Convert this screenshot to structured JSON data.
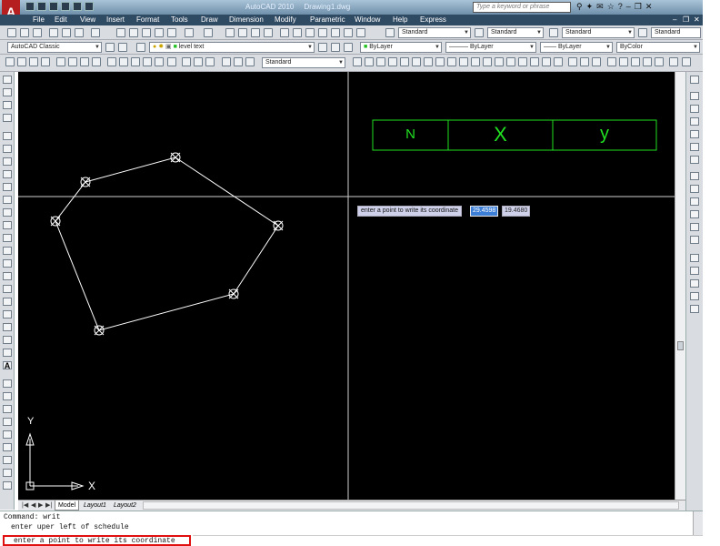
{
  "window": {
    "app_title": "AutoCAD 2010",
    "document_title": "Drawing1.dwg",
    "search_placeholder": "Type a keyword or phrase"
  },
  "menu": [
    "File",
    "Edit",
    "View",
    "Insert",
    "Format",
    "Tools",
    "Draw",
    "Dimension",
    "Modify",
    "Parametric",
    "Window",
    "Help",
    "Express"
  ],
  "toolbar1": {
    "text_style": "Standard",
    "dim_style": "Standard",
    "table_style": "Standard",
    "multileader_style": "Standard"
  },
  "toolbar2": {
    "workspace": "AutoCAD Classic",
    "layer": "level text",
    "color": "ByLayer",
    "linetype": "ByLayer",
    "lineweight": "ByLayer",
    "plot_style": "ByColor"
  },
  "toolbar3": {
    "dim_style": "Standard"
  },
  "schedule": {
    "headers": [
      "N",
      "X",
      "y"
    ]
  },
  "dynamic_input": {
    "prompt": "enter a point to write its coordinate",
    "x_value": "29.4598",
    "y_value": "19.4680"
  },
  "tabs": {
    "model": "Model",
    "layout1": "Layout1",
    "layout2": "Layout2"
  },
  "ucs": {
    "x_label": "X",
    "y_label": "Y"
  },
  "command_line": {
    "line1": "Command: writ",
    "line2": "enter uper left of schedule",
    "current_prompt": "enter a point to write its coordinate"
  },
  "colors": {
    "canvas": "#000000",
    "schedule_green": "#21e021",
    "highlight_red": "#e01010",
    "dyn_value_blue": "#3d7fd6"
  }
}
